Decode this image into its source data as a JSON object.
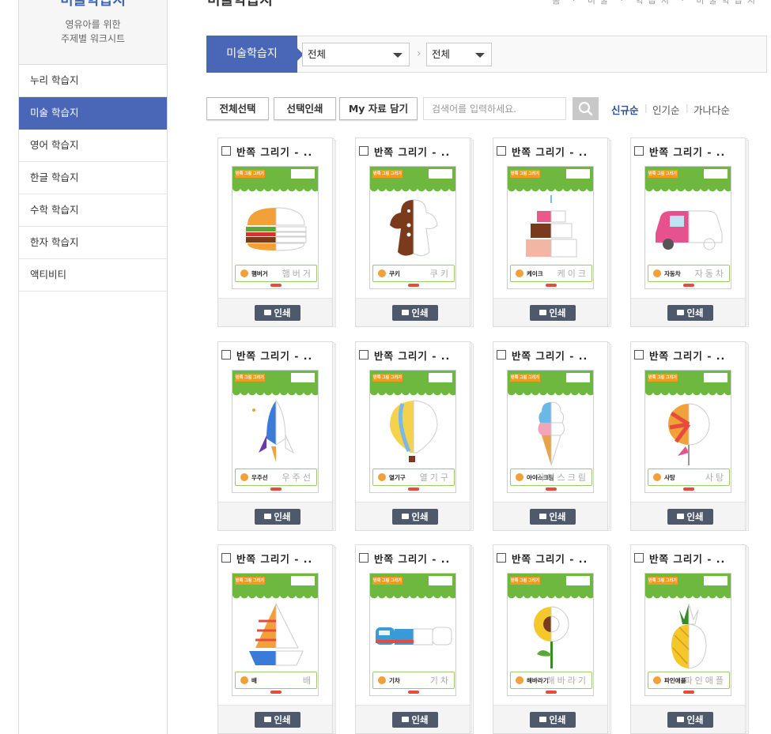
{
  "sidebar": {
    "title_partial": "미술학습지",
    "subtitle_line1": "영유아를 위한",
    "subtitle_line2": "주제별 워크시트",
    "items": [
      {
        "label": "누리 학습지"
      },
      {
        "label": "미술 학습지"
      },
      {
        "label": "영어 학습지"
      },
      {
        "label": "한글 학습지"
      },
      {
        "label": "수학 학습지"
      },
      {
        "label": "한자 학습지"
      },
      {
        "label": "액티비티"
      }
    ],
    "active_index": 1
  },
  "page": {
    "title": "미술학습지",
    "top_links": "홈 · 미술 · 학습지 · 미술학습지"
  },
  "category": {
    "label": "미술학습지",
    "select1": "전체",
    "select2": "전체",
    "separator": "›"
  },
  "toolbar": {
    "select_all": "전체선택",
    "print_selected": "선택인쇄",
    "my_save": "My 자료 담기",
    "search_placeholder": "검색어를 입력하세요.",
    "sort": [
      "신규순",
      "인기순",
      "가나다순"
    ],
    "sort_sep": "|"
  },
  "cards": [
    {
      "title": "반쪽 그리기 - ..",
      "word": "햄버거",
      "trace": "햄버거",
      "art": "hamburger"
    },
    {
      "title": "반쪽 그리기 - ..",
      "word": "쿠키",
      "trace": "쿠키",
      "art": "cookie"
    },
    {
      "title": "반쪽 그리기 - ..",
      "word": "케이크",
      "trace": "케이크",
      "art": "cake"
    },
    {
      "title": "반쪽 그리기 - ..",
      "word": "자동차",
      "trace": "자동차",
      "art": "car"
    },
    {
      "title": "반쪽 그리기 - ..",
      "word": "우주선",
      "trace": "우주선",
      "art": "rocket"
    },
    {
      "title": "반쪽 그리기 - ..",
      "word": "열기구",
      "trace": "열기구",
      "art": "balloon"
    },
    {
      "title": "반쪽 그리기 - ..",
      "word": "아이스크림",
      "trace": "아이스크림",
      "art": "icecream"
    },
    {
      "title": "반쪽 그리기 - ..",
      "word": "사탕",
      "trace": "사탕",
      "art": "candy"
    },
    {
      "title": "반쪽 그리기 - ..",
      "word": "배",
      "trace": "배",
      "art": "boat"
    },
    {
      "title": "반쪽 그리기 - ..",
      "word": "기차",
      "trace": "기차",
      "art": "train"
    },
    {
      "title": "반쪽 그리기 - ..",
      "word": "해바라기",
      "trace": "해바라기",
      "art": "sunflower"
    },
    {
      "title": "반쪽 그리기 - ..",
      "word": "파인애플",
      "trace": "파인애플",
      "art": "pineapple"
    }
  ],
  "card_sheet_tag": "반쪽 그림 그리기",
  "print_label": "인쇄",
  "colors": {
    "accent": "#4a66b7",
    "sheet_green": "#6fb83f",
    "sheet_orange": "#f39a1e",
    "print_button": "#4e5a6c"
  }
}
